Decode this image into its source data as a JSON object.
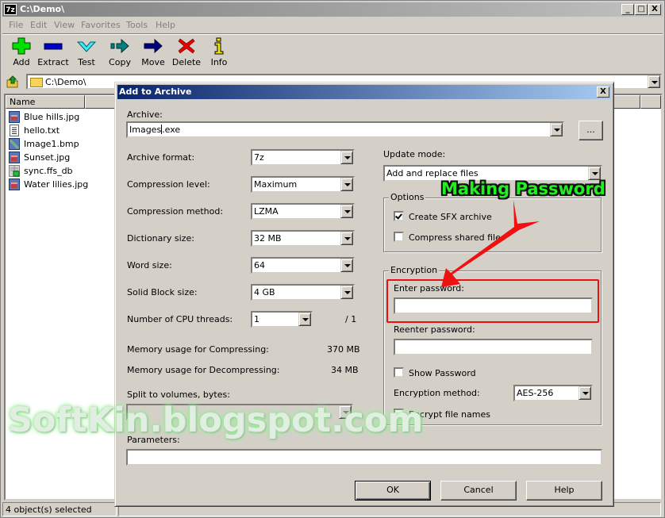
{
  "window": {
    "app_icon": "7z",
    "title": "C:\\Demo\\",
    "caption_buttons": {
      "minimize": "_",
      "maximize": "□",
      "close": "X"
    }
  },
  "menu": [
    "File",
    "Edit",
    "View",
    "Favorites",
    "Tools",
    "Help"
  ],
  "toolbar": [
    {
      "label": "Add",
      "icon": "plus-icon",
      "color": "#00e000"
    },
    {
      "label": "Extract",
      "icon": "minus-icon",
      "color": "#0000c0"
    },
    {
      "label": "Test",
      "icon": "check-chevron-icon",
      "color": "#40e0f0"
    },
    {
      "label": "Copy",
      "icon": "copy-arrow-icon",
      "color": "#008080"
    },
    {
      "label": "Move",
      "icon": "move-arrow-icon",
      "color": "#000080"
    },
    {
      "label": "Delete",
      "icon": "delete-x-icon",
      "color": "#e00000"
    },
    {
      "label": "Info",
      "icon": "info-icon",
      "color": "#f0e000"
    }
  ],
  "address": {
    "path": "C:\\Demo\\"
  },
  "file_list": {
    "columns": [
      "Name",
      "",
      ""
    ],
    "files": [
      {
        "name": "Blue hills.jpg",
        "icon": "image-file-icon"
      },
      {
        "name": "hello.txt",
        "icon": "text-file-icon"
      },
      {
        "name": "Image1.bmp",
        "icon": "bitmap-file-icon"
      },
      {
        "name": "Sunset.jpg",
        "icon": "image-file-icon"
      },
      {
        "name": "sync.ffs_db",
        "icon": "database-file-icon"
      },
      {
        "name": "Water lilies.jpg",
        "icon": "image-file-icon"
      }
    ]
  },
  "status": {
    "selection": "4 object(s) selected"
  },
  "dialog": {
    "title": "Add to Archive",
    "close": "X",
    "archive_label": "Archive:",
    "archive_value_before_caret": "Images",
    "archive_value_after_caret": ".exe",
    "browse_label": "...",
    "fields": [
      {
        "label": "Archive format:",
        "value": "7z"
      },
      {
        "label": "Compression level:",
        "value": "Maximum"
      },
      {
        "label": "Compression method:",
        "value": "LZMA"
      },
      {
        "label": "Dictionary size:",
        "value": "32 MB"
      },
      {
        "label": "Word size:",
        "value": "64"
      },
      {
        "label": "Solid Block size:",
        "value": "4 GB"
      },
      {
        "label": "Number of CPU threads:",
        "value": "1",
        "max": "/ 1"
      }
    ],
    "memory": [
      {
        "label": "Memory usage for Compressing:",
        "value": "370 MB"
      },
      {
        "label": "Memory usage for Decompressing:",
        "value": "34 MB"
      }
    ],
    "split_label": "Split to volumes, bytes:",
    "split_value": "",
    "parameters_label": "Parameters:",
    "parameters_value": "",
    "update_mode_label": "Update mode:",
    "update_mode_value": "Add and replace files",
    "options": {
      "title": "Options",
      "create_sfx": {
        "label": "Create SFX archive",
        "checked": true
      },
      "compress_shared": {
        "label": "Compress shared files",
        "checked": false
      }
    },
    "encryption": {
      "title": "Encryption",
      "enter_password_label": "Enter password:",
      "enter_password_value": "",
      "reenter_password_label": "Reenter password:",
      "reenter_password_value": "",
      "show_password": {
        "label": "Show Password",
        "checked": false
      },
      "method_label": "Encryption method:",
      "method_value": "AES-256",
      "encrypt_names": {
        "label": "Encrypt file names",
        "checked": false
      }
    },
    "buttons": {
      "ok": "OK",
      "cancel": "Cancel",
      "help": "Help"
    }
  },
  "annotation": {
    "label": "Making Password",
    "label_color": "#22ee22",
    "highlight_color": "#e81010"
  },
  "watermark": "SoftKin.blogspot.com"
}
